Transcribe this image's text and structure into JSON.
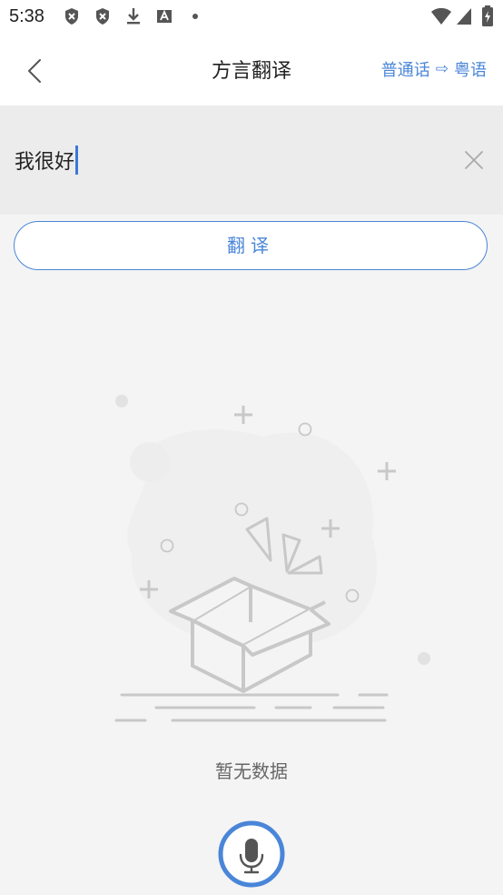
{
  "status_bar": {
    "time": "5:38",
    "icons": [
      "shield-x-icon",
      "shield-x-icon",
      "download-icon",
      "font-icon",
      "notification-dot-icon",
      "wifi-icon",
      "signal-icon",
      "battery-charging-icon"
    ]
  },
  "header": {
    "title": "方言翻译",
    "source_language": "普通话",
    "arrow": "⇨",
    "target_language": "粤语",
    "back_icon": "chevron-left-icon"
  },
  "input": {
    "value": "我很好",
    "clear_icon": "close-icon"
  },
  "translate_button": {
    "label": "翻译"
  },
  "empty_state": {
    "text": "暂无数据",
    "illustration": "empty-box-icon"
  },
  "voice_button": {
    "icon": "microphone-icon"
  },
  "colors": {
    "accent": "#4a86d8",
    "background": "#f4f4f4",
    "input_background": "#ececec",
    "illustration": "#c8c8c8"
  }
}
